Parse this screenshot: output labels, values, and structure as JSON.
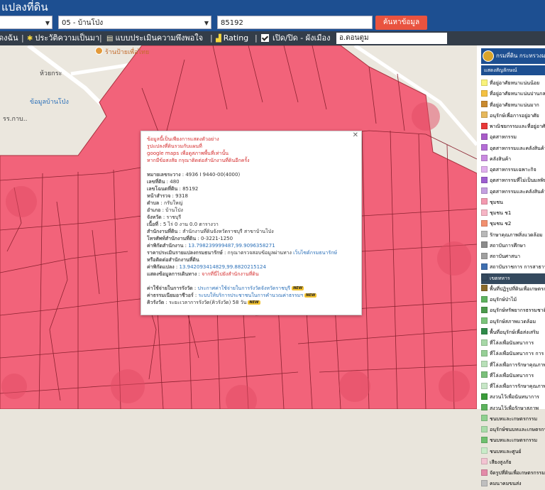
{
  "header": {
    "title": "แปลงที่ดิน"
  },
  "filters": {
    "province": "",
    "district": "05 - บ้านโป่ง",
    "parcel_no": "85192",
    "search_label": "ค้นหาข้อมูล"
  },
  "menu": {
    "items": [
      {
        "label": "ดงฉัน",
        "icon": ""
      },
      {
        "label": "ประวัติความเป็นมา",
        "icon": "sprout-icon"
      },
      {
        "label": "แบบประเมินความพึงพอใจ",
        "icon": "document-icon"
      },
      {
        "label": "Rating",
        "icon": "chart-icon"
      }
    ],
    "toggle_label": "เปิด/ปิด - ผังเมือง",
    "amphoe_value": "อ.ดอนตูม"
  },
  "map": {
    "zone_color": "#f2637a",
    "bg_labels": [
      "ห้วยกระ",
      "รร.กาบ..",
      "ร้านป้ายเพื่อไทย",
      "ข้อมูลบ้านโป่ง"
    ]
  },
  "popup": {
    "notice_lines": [
      "ข้อมูลนี้เป็นเพียงการแสดงตัวอย่าง",
      "รูปแปลงที่ดินรวมกับแผนที่",
      "google maps เพื่อดูสภาพพื้นที่เท่านั้น",
      "หากมีข้อสงสัย กรุณาติดต่อสำนักงานที่ดินอีกครั้ง"
    ],
    "fields": [
      {
        "k": "หมายเลขระวาง",
        "v": "4936 I 9440-00(4000)"
      },
      {
        "k": "เลขที่ดิน",
        "v": "480"
      },
      {
        "k": "เลขโฉนดที่ดิน",
        "v": "85192"
      },
      {
        "k": "หน้าสำรวจ",
        "v": "9318"
      },
      {
        "k": "ตำบล",
        "v": "กรับใหญ่"
      },
      {
        "k": "อำเภอ",
        "v": "บ้านโป่ง"
      },
      {
        "k": "จังหวัด",
        "v": "ราชบุรี"
      },
      {
        "k": "เนื้อที่",
        "v": "5 ไร่ 0 งาน 0.0 ตารางวา"
      },
      {
        "k": "สำนักงานที่ดิน",
        "v": "สำนักงานที่ดินจังหวัดราชบุรี สาขาบ้านโป่ง"
      },
      {
        "k": "โทรศัพท์สำนักงานที่ดิน",
        "v": "0-3221-1250"
      }
    ],
    "office_coord_label": "ค่าพิกัดสำนักงาน",
    "office_coord_value": "13.798239999487,99.9096358271",
    "appraisal_label": "ราคาประเมินรายแปลงกรมธนารักษ์",
    "appraisal_value": "กรุณาตรวจสอบข้อมูลผ่านทาง",
    "appraisal_link": "เว็บไซต์กรมธนารักษ์",
    "contact_line": "หรือติดต่อสำนักงานที่ดิน",
    "parcel_coord_label": "ค่าพิกัดแปลง",
    "parcel_coord_value": "13.942093414829,99.8820215124",
    "route_label": "แสดงข้อมูลการเดินทาง",
    "route_link": "จากที่นี่ไปยังสำนักงานที่ดิน",
    "fee_lines": [
      {
        "k": "ค่าใช้จ่ายในการรังวัด",
        "v": "ประกาศค่าใช้จ่ายในการรังวัดจังหวัดราชบุรี"
      },
      {
        "k": "ค่าธรรมเนียมอาชีวอร์",
        "v": "ระบบให้บริการประชาชนในการคำนวณค่าธรรมฯ"
      },
      {
        "k": "คิวรังวัด",
        "v": "ระยะเวลาการรังวัด(คิวรังวัด) 58 วัน"
      }
    ],
    "new_tag": "NEW"
  },
  "legend": {
    "header_title": "กรมที่ดิน กระทรวงมหาดไทย",
    "sub_title": "แสดงสัญลักษณ์",
    "items": [
      {
        "label": "ที่อยู่อาศัยหนาแน่นน้อย",
        "color": "#f9f27a"
      },
      {
        "label": "ที่อยู่อาศัยหนาแน่นปานกลาง",
        "color": "#f4c142"
      },
      {
        "label": "ที่อยู่อาศัยหนาแน่นมาก",
        "color": "#c98a2f"
      },
      {
        "label": "อนุรักษ์เพื่อการอยู่อาศัย",
        "color": "#e6b85c"
      },
      {
        "label": "พาณิชยกรรมและที่อยู่อาศัย",
        "color": "#e83838"
      },
      {
        "label": "อุตสาหกรรม",
        "color": "#a85cc8"
      },
      {
        "label": "อุตสาหกรรมและคลังสินค้า",
        "color": "#b46ed6"
      },
      {
        "label": "คลังสินค้า",
        "color": "#c98ae0"
      },
      {
        "label": "อุตสาหกรรมเฉพาะกิจ",
        "color": "#e0b0ee"
      },
      {
        "label": "อุตสาหกรรมที่ไม่เป็นมลพิษ",
        "color": "#9d5fd0"
      },
      {
        "label": "อุตสาหกรรมและคลังสินค้า",
        "color": "#c4a0e0"
      },
      {
        "label": "ชุมชน",
        "color": "#f39ab0"
      },
      {
        "label": "ชุมชน ช1",
        "color": "#f6b5c5"
      },
      {
        "label": "ชุมชน ช2",
        "color": "#f29070"
      },
      {
        "label": "รักษาคุณภาพสิ่งแวดล้อม",
        "color": "#b9b9b9"
      },
      {
        "label": "สถาบันการศึกษา",
        "color": "#8c8c8c"
      },
      {
        "label": "สถาบันศาสนา",
        "color": "#a0a0a0"
      },
      {
        "label": "สถาบันราชการ การสาธารณูปโภค",
        "color": "#3f6fb0"
      },
      {
        "label": "เขตทหาร",
        "color": "#34495e",
        "dark": true
      },
      {
        "label": "พื้นที่ปฏิรูปที่ดินเพื่อเกษตรกรรม",
        "color": "#8a6a2a"
      },
      {
        "label": "อนุรักษ์ป่าไม้",
        "color": "#5fb25f"
      },
      {
        "label": "อนุรักษ์ทรัพยากรธรรมชาติ",
        "color": "#4c9a4c"
      },
      {
        "label": "อนุรักษ์สภาพแวดล้อม",
        "color": "#7bc47b"
      },
      {
        "label": "พื้นที่อนุรักษ์เพื่อส่งเสริม",
        "color": "#2f8a4a"
      },
      {
        "label": "ที่โล่งเพื่อนันทนาการ",
        "color": "#a7d8a7"
      },
      {
        "label": "ที่โล่งเพื่อนันทนาการ การ",
        "color": "#96cf96"
      },
      {
        "label": "ที่โล่งเพื่อการรักษาคุณภาพ",
        "color": "#b8e0b8"
      },
      {
        "label": "ที่โล่งเพื่อนันทนาการ",
        "color": "#7ac07a"
      },
      {
        "label": "ที่โล่งเพื่อการรักษาคุณภาพ",
        "color": "#c6e6c6"
      },
      {
        "label": "สงวนไว้เพื่อนันทนาการ",
        "color": "#3a9c3a"
      },
      {
        "label": "สงวนไว้เพื่อรักษาสภาพ",
        "color": "#5db35d"
      },
      {
        "label": "ชนบทและเกษตรกรรม",
        "color": "#8fd08f"
      },
      {
        "label": "อนุรักษ์ชนบทและเกษตรกรรม",
        "color": "#a9dca9"
      },
      {
        "label": "ชนบทและเกษตรกรรม",
        "color": "#6fc06f"
      },
      {
        "label": "ชนบทและศูนย์",
        "color": "#c9ecc9"
      },
      {
        "label": "เสียงสูงภัย",
        "color": "#f3c4d2"
      },
      {
        "label": "จัดรูปที่ดินเพื่อเกษตรกรรม",
        "color": "#e38aa8"
      },
      {
        "label": "คมนาคมขนส่ง",
        "color": "#bfbfbf"
      }
    ]
  }
}
